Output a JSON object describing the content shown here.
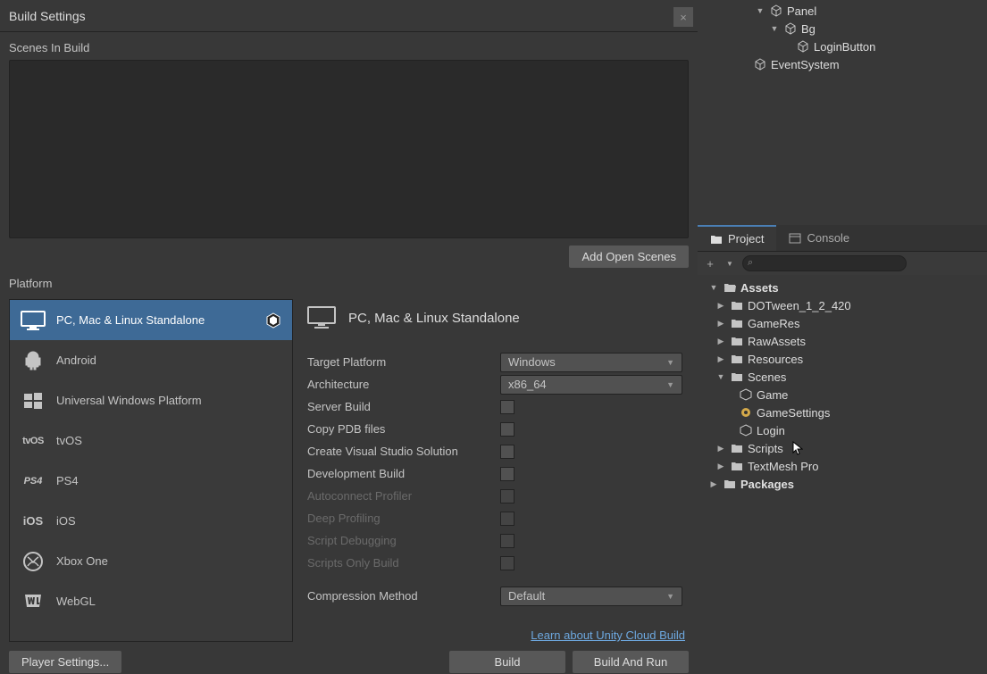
{
  "dialog": {
    "title": "Build Settings",
    "scenesLabel": "Scenes In Build",
    "addOpenScenes": "Add Open Scenes",
    "platformLabel": "Platform",
    "playerSettings": "Player Settings...",
    "build": "Build",
    "buildAndRun": "Build And Run"
  },
  "platforms": [
    {
      "name": "PC, Mac & Linux Standalone",
      "selected": true,
      "badge": true
    },
    {
      "name": "Android"
    },
    {
      "name": "Universal Windows Platform"
    },
    {
      "name": "tvOS",
      "textIcon": "tvOS"
    },
    {
      "name": "PS4",
      "textIcon": "PS4"
    },
    {
      "name": "iOS",
      "textIcon": "iOS"
    },
    {
      "name": "Xbox One"
    },
    {
      "name": "WebGL"
    }
  ],
  "detail": {
    "title": "PC, Mac & Linux Standalone",
    "targetPlatformLabel": "Target Platform",
    "targetPlatform": "Windows",
    "architectureLabel": "Architecture",
    "architecture": "x86_64",
    "serverBuild": "Server Build",
    "copyPdb": "Copy PDB files",
    "createVS": "Create Visual Studio Solution",
    "devBuild": "Development Build",
    "autoconnect": "Autoconnect Profiler",
    "deepProfiling": "Deep Profiling",
    "scriptDebugging": "Script Debugging",
    "scriptsOnly": "Scripts Only Build",
    "compressionLabel": "Compression Method",
    "compression": "Default",
    "cloudLink": "Learn about Unity Cloud Build"
  },
  "hierarchy": [
    {
      "name": "Panel",
      "indent": 3,
      "expanded": true,
      "icon": "cube"
    },
    {
      "name": "Bg",
      "indent": 4,
      "expanded": true,
      "icon": "cube"
    },
    {
      "name": "LoginButton",
      "indent": 5,
      "icon": "cube"
    },
    {
      "name": "EventSystem",
      "indent": 2,
      "icon": "cube"
    }
  ],
  "tabs": {
    "project": "Project",
    "console": "Console"
  },
  "project": {
    "root": "Assets",
    "items": [
      {
        "name": "DOTween_1_2_420",
        "indent": 1,
        "type": "folder"
      },
      {
        "name": "GameRes",
        "indent": 1,
        "type": "folder"
      },
      {
        "name": "RawAssets",
        "indent": 1,
        "type": "folder"
      },
      {
        "name": "Resources",
        "indent": 1,
        "type": "folder"
      },
      {
        "name": "Scenes",
        "indent": 1,
        "type": "folder",
        "expanded": true
      },
      {
        "name": "Game",
        "indent": 2,
        "type": "scene"
      },
      {
        "name": "GameSettings",
        "indent": 2,
        "type": "asset"
      },
      {
        "name": "Login",
        "indent": 2,
        "type": "scene"
      },
      {
        "name": "Scripts",
        "indent": 1,
        "type": "folder"
      },
      {
        "name": "TextMesh Pro",
        "indent": 1,
        "type": "folder"
      }
    ],
    "packages": "Packages"
  }
}
